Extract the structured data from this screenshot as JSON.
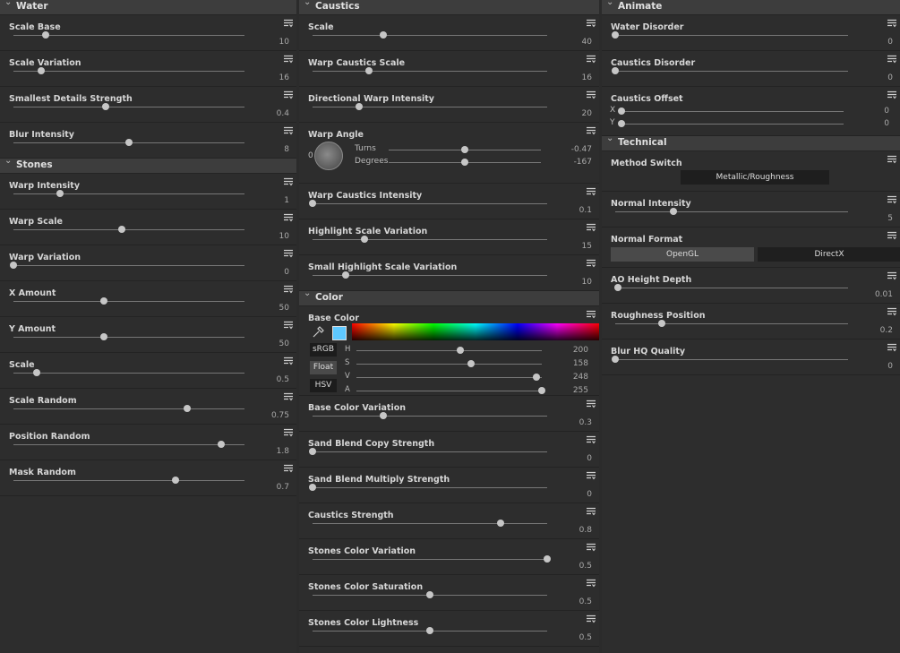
{
  "columns": [
    {
      "sections": [
        {
          "title": "Water",
          "params": [
            {
              "label": "Scale Base",
              "value": "10",
              "fraction": 0.14
            },
            {
              "label": "Scale Variation",
              "value": "16",
              "fraction": 0.12
            },
            {
              "label": "Smallest Details Strength",
              "value": "0.4",
              "fraction": 0.4
            },
            {
              "label": "Blur Intensity",
              "value": "8",
              "fraction": 0.5
            }
          ]
        },
        {
          "title": "Stones",
          "params": [
            {
              "label": "Warp Intensity",
              "value": "1",
              "fraction": 0.2
            },
            {
              "label": "Warp Scale",
              "value": "10",
              "fraction": 0.47
            },
            {
              "label": "Warp Variation",
              "value": "0",
              "fraction": 0.0
            },
            {
              "label": "X Amount",
              "value": "50",
              "fraction": 0.39
            },
            {
              "label": "Y Amount",
              "value": "50",
              "fraction": 0.39
            },
            {
              "label": "Scale",
              "value": "0.5",
              "fraction": 0.1
            },
            {
              "label": "Scale Random",
              "value": "0.75",
              "fraction": 0.75
            },
            {
              "label": "Position Random",
              "value": "1.8",
              "fraction": 0.9
            },
            {
              "label": "Mask Random",
              "value": "0.7",
              "fraction": 0.7
            }
          ]
        }
      ]
    },
    {
      "sections": [
        {
          "title": "Caustics",
          "params": [
            {
              "label": "Scale",
              "value": "40",
              "fraction": 0.3
            },
            {
              "label": "Warp Caustics Scale",
              "value": "16",
              "fraction": 0.24
            },
            {
              "label": "Directional Warp Intensity",
              "value": "20",
              "fraction": 0.2
            },
            {
              "kind": "angle",
              "label": "Warp Angle",
              "turns_label": "Turns",
              "turns_value": "-0.47",
              "degrees_label": "Degrees",
              "degrees_value": "-167",
              "turns_fraction": 0.5,
              "degrees_fraction": 0.5
            },
            {
              "label": "Warp Caustics Intensity",
              "value": "0.1",
              "fraction": 0.0
            },
            {
              "label": "Highlight Scale Variation",
              "value": "15",
              "fraction": 0.22
            },
            {
              "label": "Small Highlight Scale Variation",
              "value": "10",
              "fraction": 0.14
            }
          ]
        },
        {
          "title": "Color",
          "params": [
            {
              "kind": "color",
              "label": "Base Color",
              "swatch": "#5ec8ff",
              "btn_srgb": "sRGB",
              "btn_float": "Float",
              "btn_hsv": "HSV",
              "channels": [
                {
                  "name": "H",
                  "value": "200",
                  "fraction": 0.56
                },
                {
                  "name": "S",
                  "value": "158",
                  "fraction": 0.62
                },
                {
                  "name": "V",
                  "value": "248",
                  "fraction": 0.97
                },
                {
                  "name": "A",
                  "value": "255",
                  "fraction": 1.0
                }
              ]
            },
            {
              "label": "Base Color Variation",
              "value": "0.3",
              "fraction": 0.3
            },
            {
              "label": "Sand Blend Copy Strength",
              "value": "0",
              "fraction": 0.0
            },
            {
              "label": "Sand Blend Multiply Strength",
              "value": "0",
              "fraction": 0.0
            },
            {
              "label": "Caustics Strength",
              "value": "0.8",
              "fraction": 0.8
            },
            {
              "label": "Stones Color Variation",
              "value": "0.5",
              "fraction": 1.0
            },
            {
              "label": "Stones Color Saturation",
              "value": "0.5",
              "fraction": 0.5
            },
            {
              "label": "Stones Color Lightness",
              "value": "0.5",
              "fraction": 0.5
            }
          ]
        }
      ]
    },
    {
      "sections": [
        {
          "title": "Animate",
          "params": [
            {
              "label": "Water Disorder",
              "value": "0",
              "fraction": 0.0
            },
            {
              "label": "Caustics Disorder",
              "value": "0",
              "fraction": 0.0
            },
            {
              "kind": "xy",
              "label": "Caustics Offset",
              "x_label": "X",
              "x_value": "0",
              "y_label": "Y",
              "y_value": "0"
            }
          ]
        },
        {
          "title": "Technical",
          "params": [
            {
              "kind": "button",
              "label": "Method Switch",
              "button": "Metallic/Roughness"
            },
            {
              "label": "Normal Intensity",
              "value": "5",
              "fraction": 0.25
            },
            {
              "kind": "toggle",
              "label": "Normal Format",
              "options": [
                "OpenGL",
                "DirectX"
              ],
              "selected": 0
            },
            {
              "label": "AO Height Depth",
              "value": "0.01",
              "fraction": 0.01
            },
            {
              "label": "Roughness Position",
              "value": "0.2",
              "fraction": 0.2
            },
            {
              "label": "Blur HQ Quality",
              "value": "0",
              "fraction": 0.0
            }
          ]
        }
      ]
    }
  ],
  "icons": {
    "collapse": "chevron-down-icon",
    "param_menu": "param-menu-icon",
    "eyedropper": "eyedropper-icon"
  }
}
